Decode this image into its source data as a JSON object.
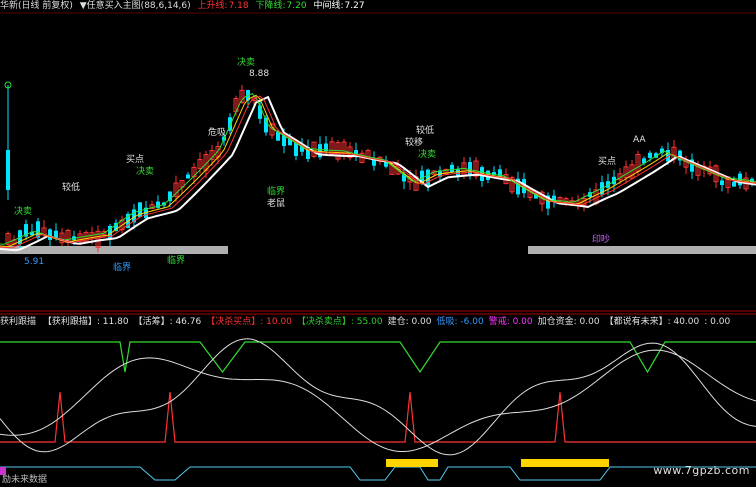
{
  "upper_header": {
    "title": "华新(日线 前复权)",
    "indicator": "▼任意买入主图(88,6,14,6)",
    "upper_line_label": "上升线:",
    "upper_line_value": "7.18",
    "lower_line_label": "下降线:",
    "lower_line_value": "7.20",
    "mid_line_label": "中间线:",
    "mid_line_value": "7.27"
  },
  "lower_header": {
    "name": "获利跟描",
    "items": [
      {
        "label": "【获利跟描】",
        "value": ": 11.80",
        "color": "#e0e0e0"
      },
      {
        "label": "【活筹】",
        "value": ": 46.76",
        "color": "#e0e0e0"
      },
      {
        "label": "【决杀买点】",
        "value": ": 10.00",
        "color": "#ff3333"
      },
      {
        "label": "【决杀卖点】",
        "value": ": 55.00",
        "color": "#33cc33"
      },
      {
        "label": "建仓",
        "value": ": 0.00",
        "color": "#e0e0e0"
      },
      {
        "label": "低吸",
        "value": ": -6.00",
        "color": "#3399ff"
      },
      {
        "label": "警戒",
        "value": ": 0.00",
        "color": "#ff33ff"
      },
      {
        "label": "加仓资金",
        "value": ": 0.00",
        "color": "#e0e0e0"
      },
      {
        "label": "【都说有未来】",
        "value": ": 40.00",
        "color": "#e0e0e0"
      },
      {
        "label": "",
        "value": ": 0.00",
        "color": "#e0e0e0"
      }
    ]
  },
  "annotations": {
    "sell_top": "决卖",
    "price_top": "8.88",
    "buy_1": "买点",
    "buy_2": "买点",
    "sell_1": "决卖",
    "low_suck": "较低",
    "danger": "危吸",
    "critical_1": "临界",
    "critical_2": "临界",
    "critical_3": "临界",
    "old_rat": "老鼠",
    "ladder": "较低",
    "ladder_2": "较移",
    "sell_2": "决卖",
    "buy_3": "买点",
    "mark_aa": "AA",
    "mark_print": "印吵",
    "low_price": "5.91",
    "left_sell": "决卖"
  },
  "bottom_label": "励未来数据",
  "watermark": "www.7gpzb.com",
  "colors": {
    "up": "#ff3333",
    "down": "#00e5ff",
    "ma_white": "#ffffff",
    "ma_yellow": "#ffd400",
    "ma_green": "#33dd33",
    "gray_band": "#b0b0b0",
    "yellow_band": "#ffd400"
  }
}
